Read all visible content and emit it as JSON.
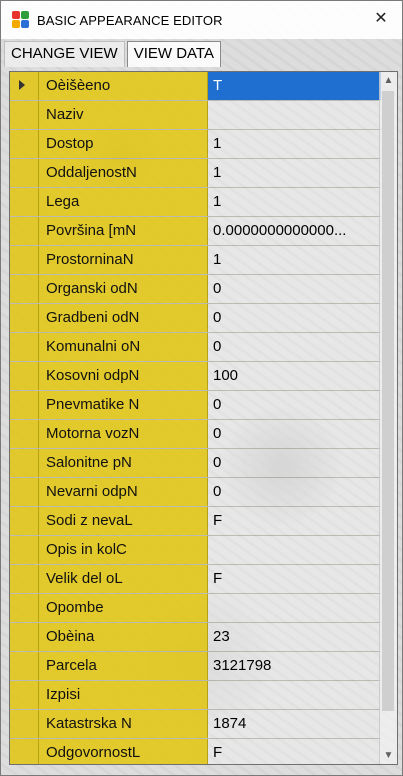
{
  "window": {
    "title": "BASIC APPEARANCE EDITOR",
    "close_glyph": "✕"
  },
  "tabs": [
    {
      "label": "CHANGE VIEW",
      "active": false
    },
    {
      "label": "VIEW DATA",
      "active": true
    }
  ],
  "rows": [
    {
      "name": "Oèišèeno",
      "value": "T",
      "selected": true
    },
    {
      "name": "Naziv",
      "value": ""
    },
    {
      "name": "Dostop",
      "value": "1"
    },
    {
      "name": "OddaljenostN",
      "value": "1"
    },
    {
      "name": "Lega",
      "value": "1"
    },
    {
      "name": "Površina [mN",
      "value": "0.0000000000000..."
    },
    {
      "name": "ProstorninaN",
      "value": "1"
    },
    {
      "name": "Organski odN",
      "value": "0"
    },
    {
      "name": "Gradbeni odN",
      "value": "0"
    },
    {
      "name": "Komunalni oN",
      "value": "0"
    },
    {
      "name": "Kosovni odpN",
      "value": "100"
    },
    {
      "name": "Pnevmatike N",
      "value": "0"
    },
    {
      "name": "Motorna vozN",
      "value": "0"
    },
    {
      "name": "Salonitne pN",
      "value": "0"
    },
    {
      "name": "Nevarni odpN",
      "value": "0"
    },
    {
      "name": "Sodi z nevaL",
      "value": "F"
    },
    {
      "name": "Opis in kolC",
      "value": ""
    },
    {
      "name": "Velik del oL",
      "value": "F"
    },
    {
      "name": "Opombe",
      "value": ""
    },
    {
      "name": "Obèina",
      "value": "23"
    },
    {
      "name": "Parcela",
      "value": "3121798"
    },
    {
      "name": "Izpisi",
      "value": ""
    },
    {
      "name": "Katastrska N",
      "value": "1874"
    },
    {
      "name": "OdgovornostL",
      "value": "F"
    }
  ],
  "scrollbar": {
    "up_glyph": "▲",
    "down_glyph": "▼"
  },
  "colors": {
    "row_highlight": "#e2c400",
    "selection": "#1f6fd1"
  }
}
